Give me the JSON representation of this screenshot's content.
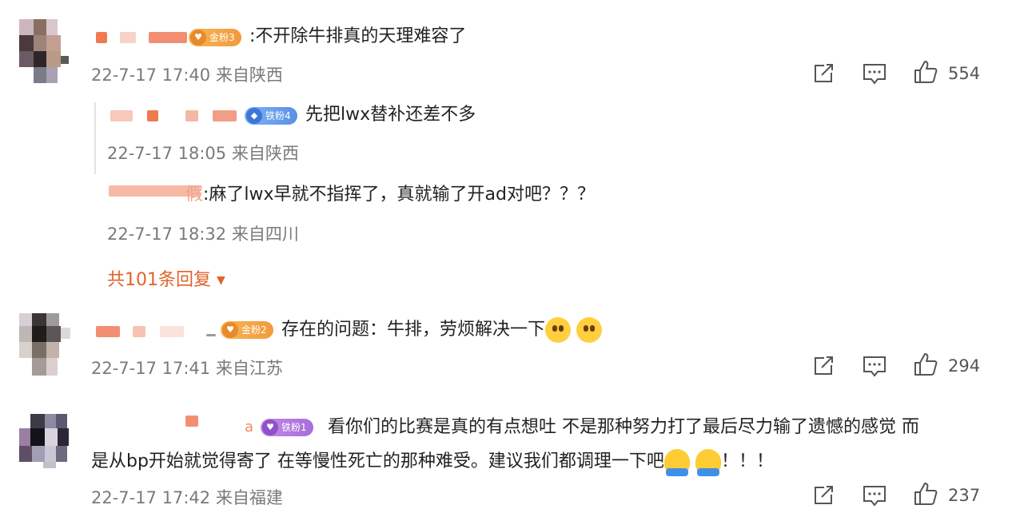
{
  "comments": [
    {
      "badge": "金粉3",
      "text": "不开除牛排真的天理难容了",
      "time": "22-7-17 17:40",
      "location": "来自陕西",
      "likes": "554"
    },
    {
      "badge": "金粉2",
      "text": "存在的问题：牛排，劳烦解决一下",
      "emojis": [
        "happy-face",
        "happy-face"
      ],
      "time": "22-7-17 17:41",
      "location": "来自江苏",
      "likes": "294"
    },
    {
      "name_fragment": "a",
      "badge": "铁粉1",
      "line1": "看你们的比赛是真的有点想吐 不是那种努力打了最后尽力输了遗憾的感觉 而",
      "line2": "是从bp开始就觉得寄了 在等慢性死亡的那种难受。建议我们都调理一下吧",
      "line2_suffix": "！！！",
      "emojis": [
        "hug-face",
        "hug-face"
      ],
      "time": "22-7-17 17:42",
      "location": "来自福建",
      "likes": "237"
    }
  ],
  "replies": [
    {
      "badge": "铁粉4",
      "text": "先把lwx替补还差不多",
      "time": "22-7-17 18:05",
      "location": "来自陕西"
    },
    {
      "name_fragment": "假",
      "text": ":麻了lwx早就不指挥了，真就输了开ad对吧？？？",
      "time": "22-7-17 18:32",
      "location": "来自四川"
    }
  ],
  "more_replies": "共101条回复",
  "icons": {
    "share": "share-icon",
    "comment": "comment-icon",
    "like": "thumbs-up-icon",
    "expand": "caret-down-icon"
  },
  "colors": {
    "accent": "#e0632c",
    "meta_text": "#7a7a7a",
    "gold_badge": "#f29a3b",
    "iron_badge": "#5a8fe6",
    "purple_badge": "#a66ed9"
  }
}
